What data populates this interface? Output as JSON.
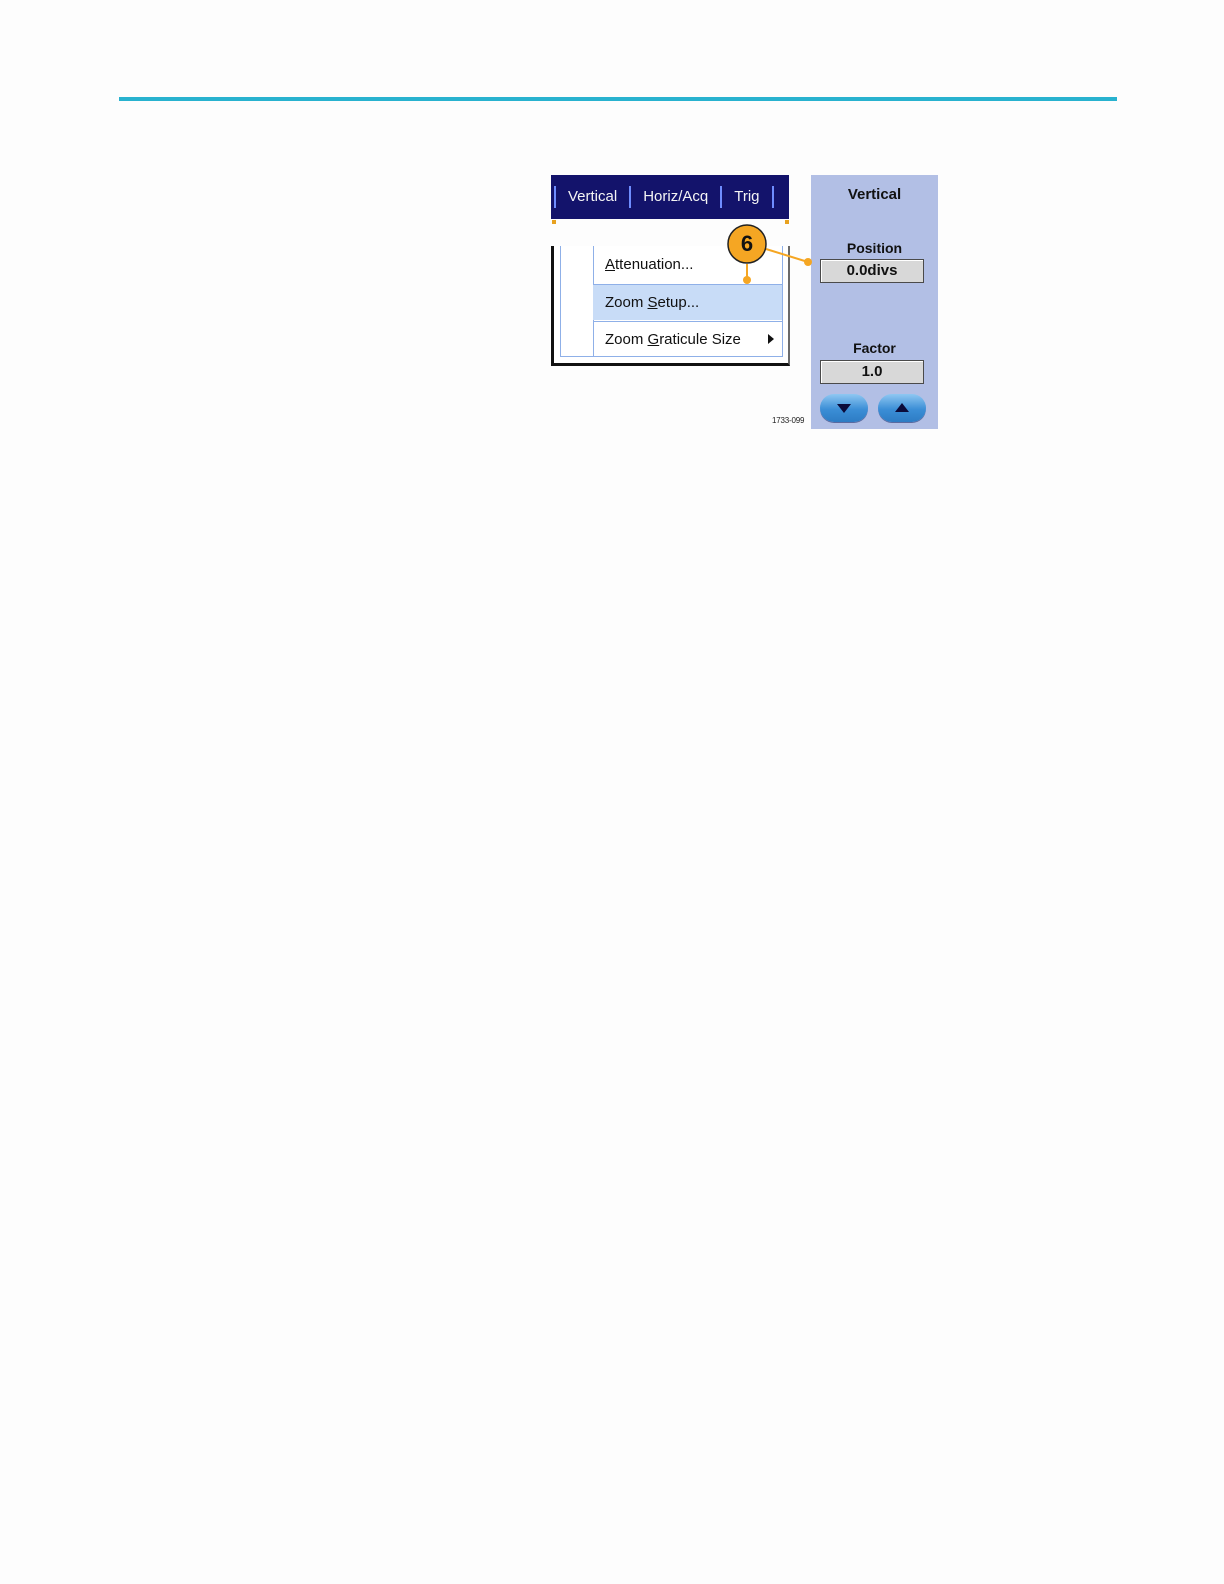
{
  "menubar": {
    "items": [
      "Vertical",
      "Horiz/Acq",
      "Trig"
    ]
  },
  "dropdown": {
    "items": [
      {
        "pre": "",
        "accel": "A",
        "post": "ttenuation..."
      },
      {
        "pre": "Zoom ",
        "accel": "S",
        "post": "etup..."
      },
      {
        "pre": "Zoom ",
        "accel": "G",
        "post": "raticule Size"
      }
    ],
    "highlighted_index": 1
  },
  "side_panel": {
    "title": "Vertical",
    "position_label": "Position",
    "position_value": "0.0divs",
    "factor_label": "Factor",
    "factor_value": "1.0"
  },
  "callout": {
    "number": "6",
    "color": "#f5a623"
  },
  "figure_id": "1733-099",
  "colors": {
    "top_rule": "#28b2cf",
    "menubar_bg": "#13136b",
    "panel_bg": "#b2bfe5",
    "highlight": "#c8dcf7"
  }
}
